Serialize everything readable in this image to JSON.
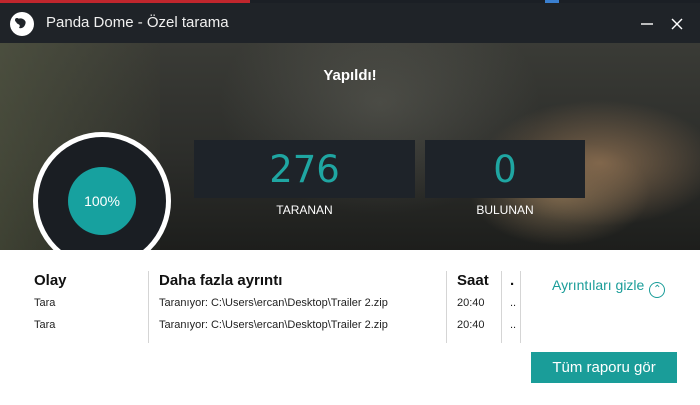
{
  "window": {
    "title": "Panda Dome - Özel tarama",
    "controls": {
      "minimize": "minimize-icon",
      "close": "close-icon"
    }
  },
  "scan": {
    "status": "Yapıldı!",
    "progress_label": "100%",
    "progress": 1.0,
    "scanned_count": "276",
    "scanned_label": "TARANAN",
    "found_count": "0",
    "found_label": "BULUNAN"
  },
  "log": {
    "columns": [
      "Olay",
      "Daha fazla ayrıntı",
      "Saat",
      "."
    ],
    "rows": [
      [
        "Tara",
        "Taranıyor: C:\\Users\\ercan\\Desktop\\Trailer 2.zip",
        "20:40",
        ".."
      ],
      [
        "Tara",
        "Taranıyor: C:\\Users\\ercan\\Desktop\\Trailer 2.zip",
        "20:40",
        ".."
      ]
    ]
  },
  "actions": {
    "hide_details": "Ayrıntıları gizle",
    "full_report": "Tüm raporu gör"
  },
  "colors": {
    "accent": "#1a9d99",
    "titlebar": "#1f2328"
  }
}
